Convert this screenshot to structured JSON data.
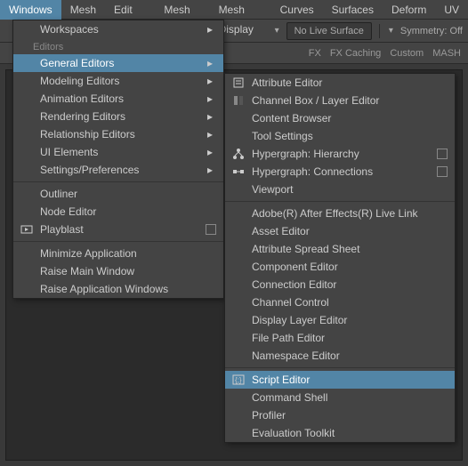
{
  "menubar": {
    "items": [
      "Windows",
      "Mesh",
      "Edit Mesh",
      "Mesh Tools",
      "Mesh Display",
      "Curves",
      "Surfaces",
      "Deform",
      "UV"
    ],
    "active_index": 0
  },
  "toolbar": {
    "live_surface": "No Live Surface",
    "symmetry": "Symmetry: Off"
  },
  "secondbar": {
    "tabs": [
      "FX",
      "FX Caching",
      "Custom",
      "MASH"
    ]
  },
  "primary_menu": {
    "sections": [
      {
        "label": "Workspaces",
        "arrow": true
      },
      {
        "header": "Editors"
      },
      {
        "label": "General Editors",
        "arrow": true,
        "active": true
      },
      {
        "label": "Modeling Editors",
        "arrow": true
      },
      {
        "label": "Animation Editors",
        "arrow": true
      },
      {
        "label": "Rendering Editors",
        "arrow": true
      },
      {
        "label": "Relationship Editors",
        "arrow": true
      },
      {
        "label": "UI Elements",
        "arrow": true
      },
      {
        "label": "Settings/Preferences",
        "arrow": true
      },
      {
        "sep": true
      },
      {
        "label": "Outliner"
      },
      {
        "label": "Node Editor"
      },
      {
        "label": "Playblast",
        "box": true,
        "gutter_icon": "playblast"
      },
      {
        "sep": true
      },
      {
        "label": "Minimize Application"
      },
      {
        "label": "Raise Main Window"
      },
      {
        "label": "Raise Application Windows"
      }
    ]
  },
  "secondary_menu": {
    "items": [
      {
        "label": "Attribute Editor",
        "gutter_icon": "attr"
      },
      {
        "label": "Channel Box / Layer Editor",
        "gutter_icon": "channel"
      },
      {
        "label": "Content Browser"
      },
      {
        "label": "Tool Settings"
      },
      {
        "label": "Hypergraph: Hierarchy",
        "box": true,
        "gutter_icon": "hier"
      },
      {
        "label": "Hypergraph: Connections",
        "box": true,
        "gutter_icon": "conn"
      },
      {
        "label": "Viewport"
      },
      {
        "sep": true
      },
      {
        "label": "Adobe(R) After Effects(R) Live Link"
      },
      {
        "label": "Asset Editor"
      },
      {
        "label": "Attribute Spread Sheet"
      },
      {
        "label": "Component Editor"
      },
      {
        "label": "Connection Editor"
      },
      {
        "label": "Channel Control"
      },
      {
        "label": "Display Layer Editor"
      },
      {
        "label": "File Path Editor"
      },
      {
        "label": "Namespace Editor"
      },
      {
        "sep": true
      },
      {
        "label": "Script Editor",
        "active": true,
        "gutter_icon": "script"
      },
      {
        "label": "Command Shell"
      },
      {
        "label": "Profiler"
      },
      {
        "label": "Evaluation Toolkit"
      }
    ]
  }
}
